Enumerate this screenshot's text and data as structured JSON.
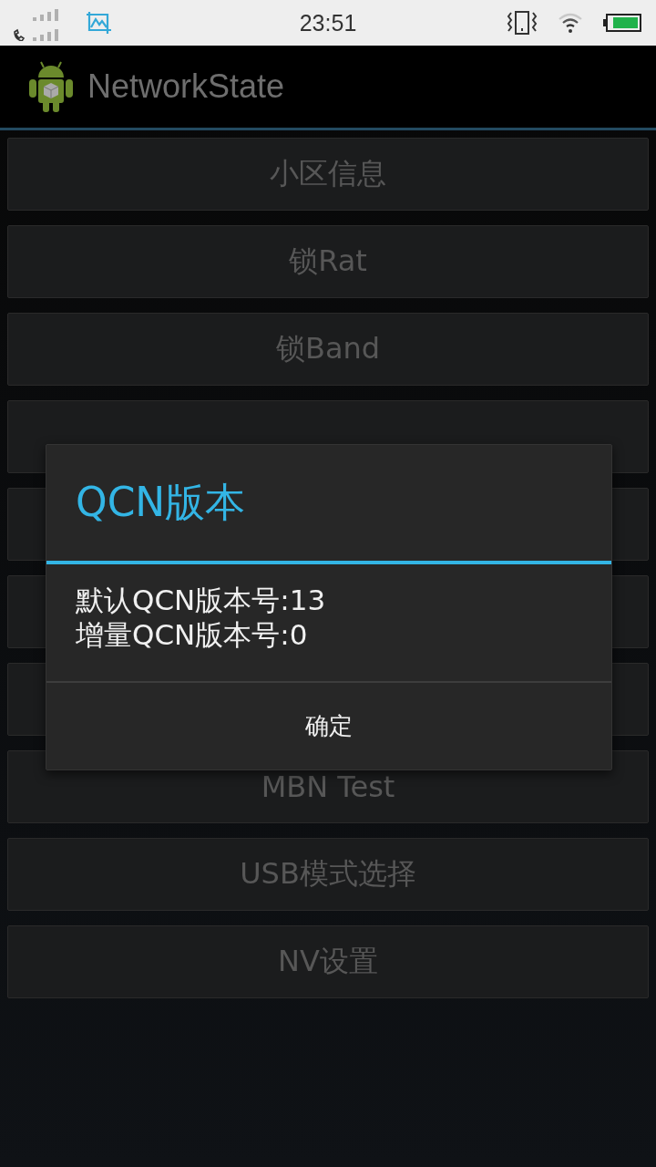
{
  "status_bar": {
    "time": "23:51"
  },
  "app_bar": {
    "title": "NetworkState"
  },
  "buttons": [
    {
      "kind": "labeled",
      "label": "小区信息"
    },
    {
      "kind": "labeled",
      "label": "锁Rat"
    },
    {
      "kind": "labeled",
      "label": "锁Band"
    },
    {
      "kind": "covered"
    },
    {
      "kind": "covered"
    },
    {
      "kind": "covered"
    },
    {
      "kind": "covered"
    },
    {
      "kind": "labeled",
      "label": "MBN Test"
    },
    {
      "kind": "labeled",
      "label": "USB模式选择"
    },
    {
      "kind": "labeled",
      "label": "NV设置"
    }
  ],
  "dialog": {
    "title": "QCN版本",
    "lines": [
      "默认QCN版本号:13",
      "增量QCN版本号:0"
    ],
    "button": "确定"
  }
}
